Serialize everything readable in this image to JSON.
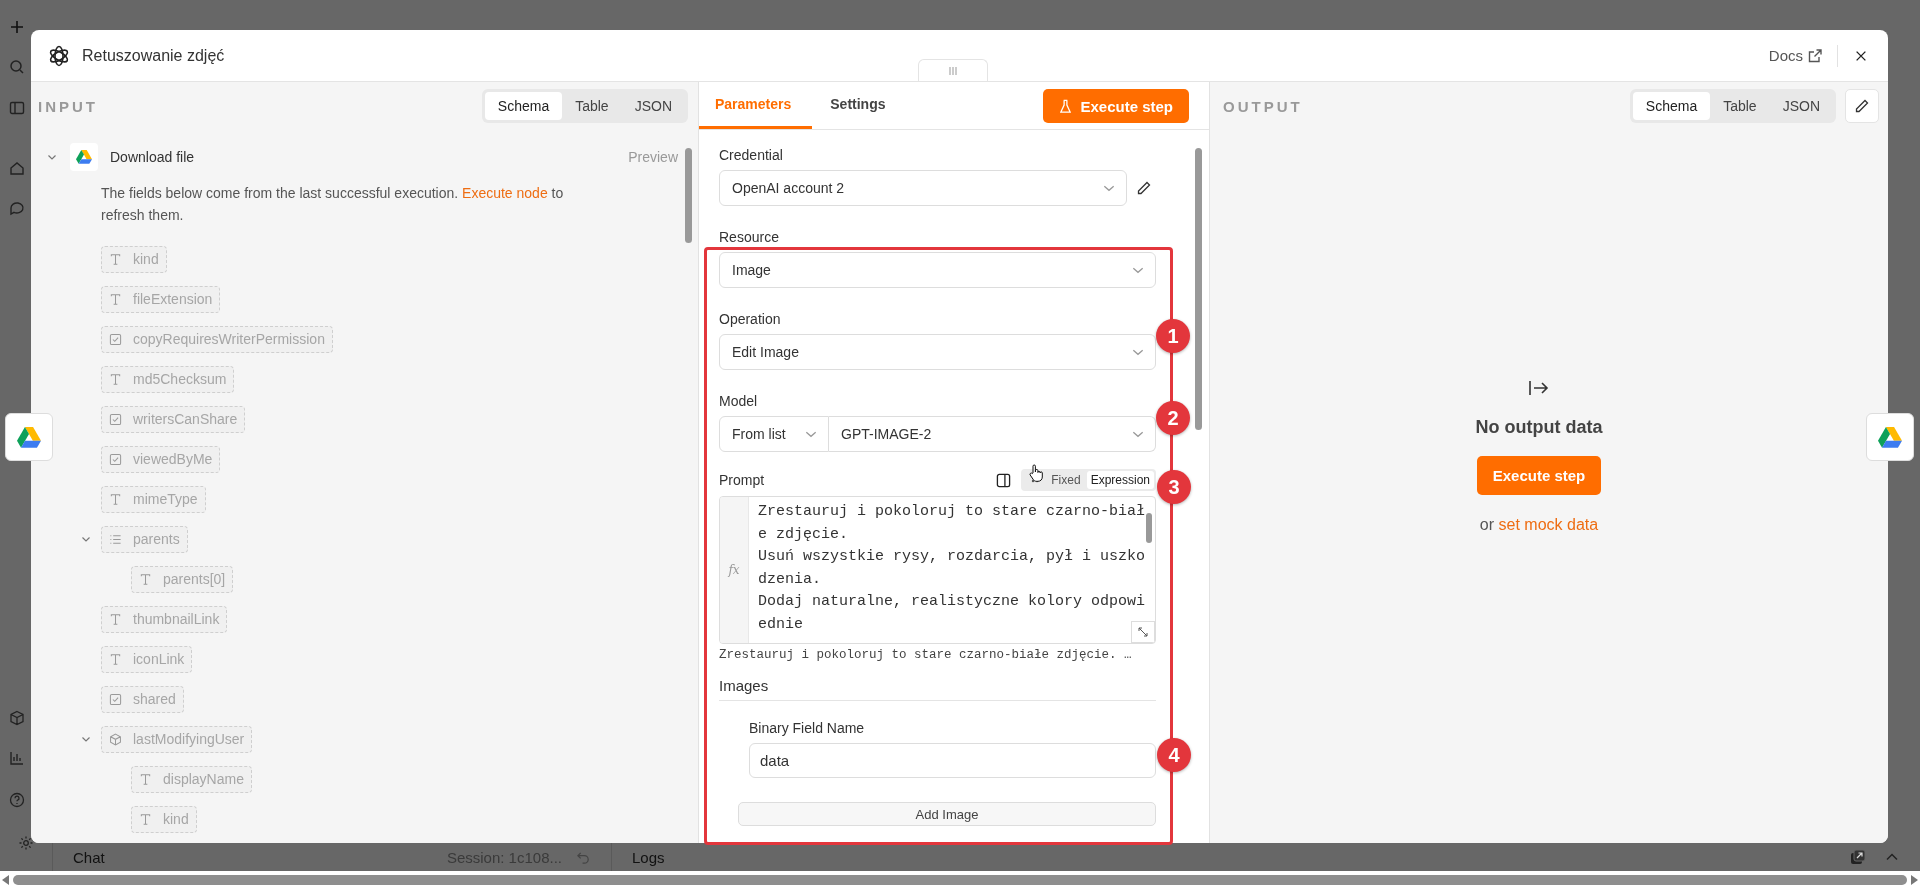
{
  "window": {
    "title": "Retuszowanie zdjęć",
    "docs_link": "Docs"
  },
  "input_panel": {
    "heading": "INPUT",
    "view_tabs": [
      {
        "label": "Schema",
        "selected": true
      },
      {
        "label": "Table",
        "selected": false
      },
      {
        "label": "JSON",
        "selected": false
      }
    ],
    "node": {
      "name": "Download file",
      "expanded": true,
      "preview": "Preview"
    },
    "notice": {
      "text": "The fields below come from the last successful execution.",
      "link": "Execute node",
      "after": "to refresh them."
    },
    "fields": [
      {
        "name": "kind",
        "kind": "string"
      },
      {
        "name": "fileExtension",
        "kind": "string"
      },
      {
        "name": "copyRequiresWriterPermission",
        "kind": "boolean"
      },
      {
        "name": "md5Checksum",
        "kind": "string"
      },
      {
        "name": "writersCanShare",
        "kind": "boolean"
      },
      {
        "name": "viewedByMe",
        "kind": "boolean"
      },
      {
        "name": "mimeType",
        "kind": "string"
      },
      {
        "name": "parents",
        "kind": "array",
        "expanded": true,
        "children": [
          {
            "name": "parents[0]",
            "kind": "string"
          }
        ]
      },
      {
        "name": "thumbnailLink",
        "kind": "string"
      },
      {
        "name": "iconLink",
        "kind": "string"
      },
      {
        "name": "shared",
        "kind": "boolean"
      },
      {
        "name": "lastModifyingUser",
        "kind": "object",
        "expanded": true,
        "children": [
          {
            "name": "displayName",
            "kind": "string"
          },
          {
            "name": "kind",
            "kind": "string"
          }
        ]
      }
    ]
  },
  "parameters_panel": {
    "tabs": [
      {
        "label": "Parameters",
        "selected": true
      },
      {
        "label": "Settings",
        "selected": false
      }
    ],
    "execute_button": "Execute step",
    "credential": {
      "label": "Credential",
      "value": "OpenAI account 2"
    },
    "resource": {
      "label": "Resource",
      "value": "Image"
    },
    "operation": {
      "label": "Operation",
      "value": "Edit Image"
    },
    "model": {
      "label": "Model",
      "mode": "From list",
      "value": "GPT-IMAGE-2"
    },
    "prompt": {
      "label": "Prompt",
      "modes": [
        {
          "label": "Fixed",
          "selected": false
        },
        {
          "label": "Expression",
          "selected": true
        }
      ],
      "gutter": "fx",
      "value": "Zrestauruj i pokoloruj to stare czarno-białe zdjęcie.\nUsuń wszystkie rysy, rozdarcia, pył i uszkodzenia.\nDodaj naturalne, realistyczne kolory odpowiednie",
      "preview": "Zrestauruj i pokoloruj to stare czarno-białe zdjęcie. …"
    },
    "images": {
      "title": "Images",
      "field_label": "Binary Field Name",
      "field_value": "data",
      "add_button": "Add Image"
    }
  },
  "output_panel": {
    "heading": "OUTPUT",
    "view_tabs": [
      {
        "label": "Schema",
        "selected": true
      },
      {
        "label": "Table",
        "selected": false
      },
      {
        "label": "JSON",
        "selected": false
      }
    ],
    "empty_title": "No output data",
    "execute_button": "Execute step",
    "mock_prefix": "or",
    "mock_link": "set mock data"
  },
  "annotations": [
    {
      "number": "1"
    },
    {
      "number": "2"
    },
    {
      "number": "3"
    },
    {
      "number": "4"
    }
  ],
  "bottom_bar": {
    "chat": "Chat",
    "session": "Session: 1c108...",
    "logs": "Logs"
  }
}
